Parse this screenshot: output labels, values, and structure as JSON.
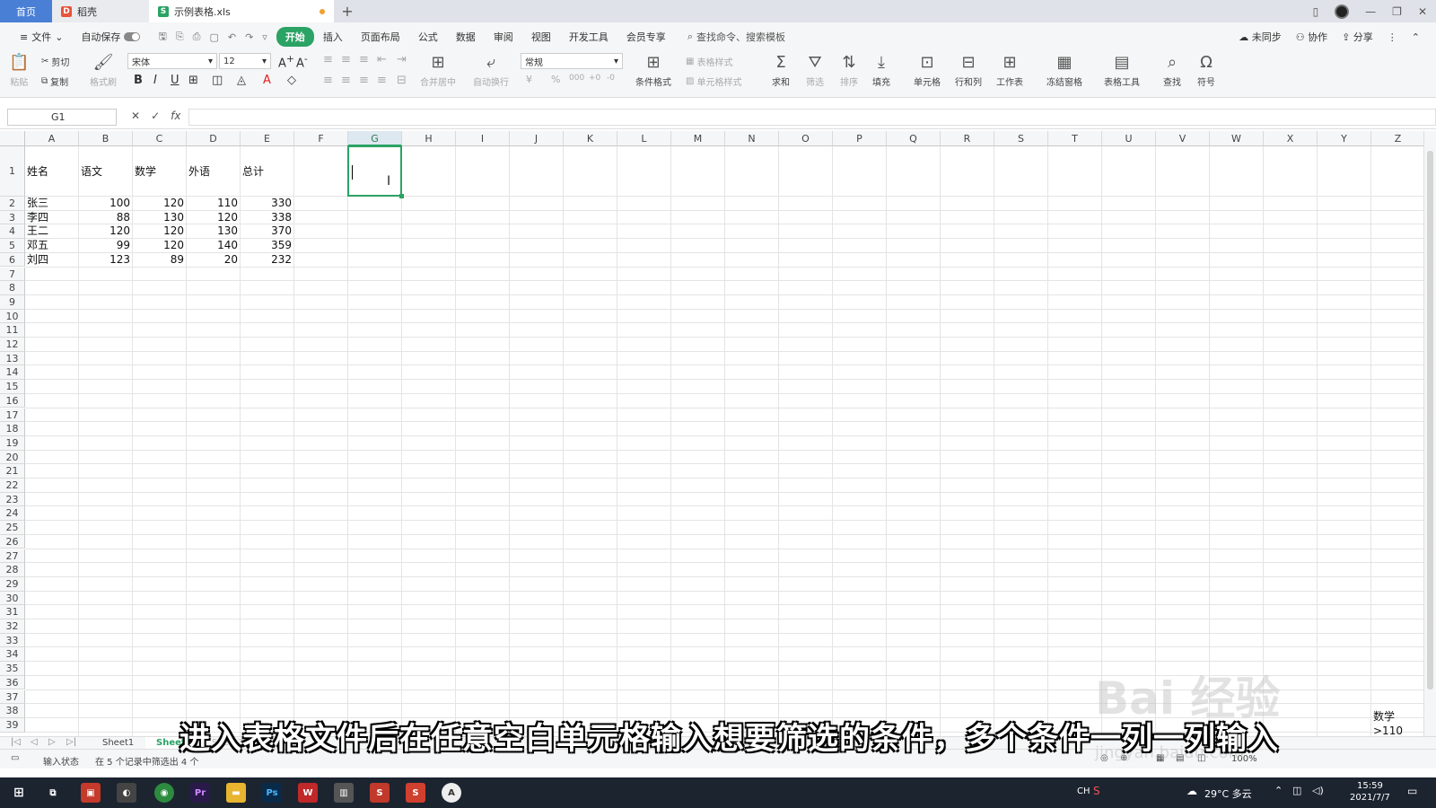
{
  "tabs": {
    "home": "首页",
    "daoke": "稻壳",
    "file": "示例表格.xls"
  },
  "menu": {
    "file": "文件",
    "autosave": "自动保存",
    "items": [
      "开始",
      "插入",
      "页面布局",
      "公式",
      "数据",
      "审阅",
      "视图",
      "开发工具",
      "会员专享"
    ],
    "search": "查找命令、搜索模板",
    "right": [
      "未同步",
      "协作",
      "分享"
    ]
  },
  "ribbon": {
    "paste": "粘贴",
    "cut": "剪切",
    "copy": "复制",
    "format_painter": "格式刷",
    "font_name": "宋体",
    "font_size": "12",
    "merge": "合并居中",
    "wrap": "自动换行",
    "number_format": "常规",
    "cond_format": "条件格式",
    "table_style": "表格样式",
    "cell_style": "单元格样式",
    "sum": "求和",
    "filter": "筛选",
    "sort": "排序",
    "fill": "填充",
    "cell": "单元格",
    "rowcol": "行和列",
    "worksheet": "工作表",
    "freeze": "冻结窗格",
    "table_tools": "表格工具",
    "find": "查找",
    "symbol": "符号"
  },
  "formula": {
    "namebox": "G1",
    "fx": "fx"
  },
  "grid": {
    "columns": [
      "A",
      "B",
      "C",
      "D",
      "E",
      "F",
      "G",
      "H",
      "I",
      "J",
      "K",
      "L",
      "M",
      "N",
      "O",
      "P",
      "Q",
      "R",
      "S",
      "T",
      "U",
      "V",
      "W",
      "X",
      "Y",
      "Z"
    ],
    "selected_column": "G",
    "row_count": 39,
    "header": [
      "姓名",
      "语文",
      "数学",
      "外语",
      "总计"
    ],
    "rows": [
      [
        "张三",
        "100",
        "120",
        "110",
        "330"
      ],
      [
        "李四",
        "88",
        "130",
        "120",
        "338"
      ],
      [
        "王二",
        "120",
        "120",
        "130",
        "370"
      ],
      [
        "邓五",
        "99",
        "120",
        "140",
        "359"
      ],
      [
        "刘四",
        "123",
        "89",
        "20",
        "232"
      ]
    ]
  },
  "sheets": [
    "Sheet1",
    "Sheet2",
    "Sheet3"
  ],
  "status": {
    "mode": "输入状态",
    "filter_info": "在 5 个记录中筛选出 4 个",
    "zoom": "100%"
  },
  "taskbar": {
    "weather": "29°C 多云",
    "ime": "CH",
    "time": "15:59",
    "date": "2021/7/7"
  },
  "overlay": {
    "subtitle": "进入表格文件后在任意空白单元格输入想要筛选的条件，多个条件一列一列输入",
    "watermark": "Bai 经验",
    "watermark_url": "jingyan.baidu.com",
    "criteria_label": "数学",
    "criteria_value": ">110"
  }
}
